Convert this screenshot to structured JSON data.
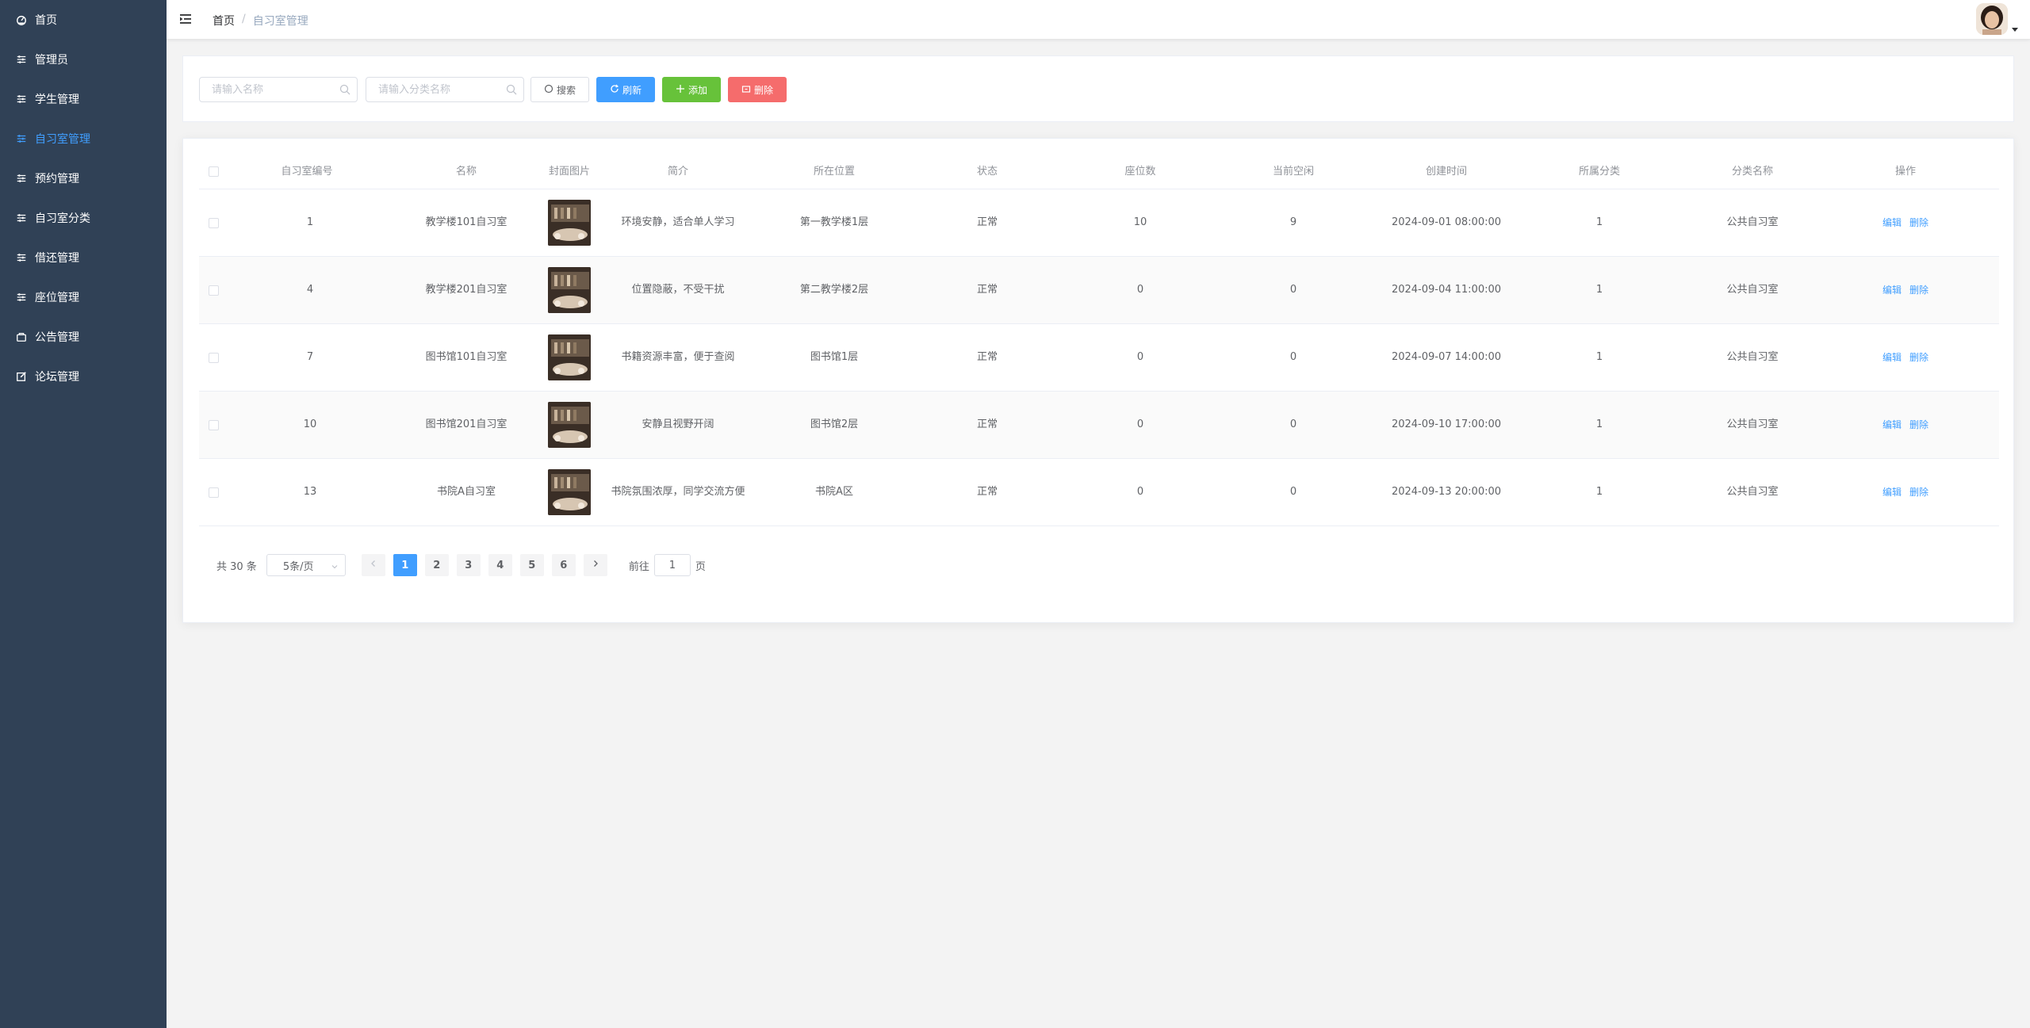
{
  "sidebar": {
    "items": [
      {
        "label": "首页",
        "icon": "dashboard-icon",
        "active": false
      },
      {
        "label": "管理员",
        "icon": "list-icon",
        "active": false
      },
      {
        "label": "学生管理",
        "icon": "list-icon",
        "active": false
      },
      {
        "label": "自习室管理",
        "icon": "list-icon",
        "active": true
      },
      {
        "label": "预约管理",
        "icon": "list-icon",
        "active": false
      },
      {
        "label": "自习室分类",
        "icon": "list-icon",
        "active": false
      },
      {
        "label": "借还管理",
        "icon": "list-icon",
        "active": false
      },
      {
        "label": "座位管理",
        "icon": "list-icon",
        "active": false
      },
      {
        "label": "公告管理",
        "icon": "bag-icon",
        "active": false
      },
      {
        "label": "论坛管理",
        "icon": "edit-icon",
        "active": false
      }
    ]
  },
  "header": {
    "breadcrumb": {
      "home": "首页",
      "separator": "/",
      "current": "自习室管理"
    }
  },
  "search": {
    "name_placeholder": "请输入名称",
    "category_placeholder": "请输入分类名称",
    "search_label": "搜索",
    "refresh_label": "刷新",
    "add_label": "添加",
    "delete_label": "删除"
  },
  "table": {
    "headers": {
      "no": "自习室编号",
      "name": "名称",
      "img": "封面图片",
      "intro": "简介",
      "loc": "所在位置",
      "status": "状态",
      "seats": "座位数",
      "free": "当前空闲",
      "time": "创建时间",
      "cat": "所属分类",
      "catname": "分类名称",
      "ops": "操作"
    },
    "rows": [
      {
        "no": "1",
        "name": "教学楼101自习室",
        "intro": "环境安静，适合单人学习",
        "loc": "第一教学楼1层",
        "status": "正常",
        "seats": "10",
        "free": "9",
        "time": "2024-09-01 08:00:00",
        "cat": "1",
        "catname": "公共自习室"
      },
      {
        "no": "4",
        "name": "教学楼201自习室",
        "intro": "位置隐蔽，不受干扰",
        "loc": "第二教学楼2层",
        "status": "正常",
        "seats": "0",
        "free": "0",
        "time": "2024-09-04 11:00:00",
        "cat": "1",
        "catname": "公共自习室"
      },
      {
        "no": "7",
        "name": "图书馆101自习室",
        "intro": "书籍资源丰富，便于查阅",
        "loc": "图书馆1层",
        "status": "正常",
        "seats": "0",
        "free": "0",
        "time": "2024-09-07 14:00:00",
        "cat": "1",
        "catname": "公共自习室"
      },
      {
        "no": "10",
        "name": "图书馆201自习室",
        "intro": "安静且视野开阔",
        "loc": "图书馆2层",
        "status": "正常",
        "seats": "0",
        "free": "0",
        "time": "2024-09-10 17:00:00",
        "cat": "1",
        "catname": "公共自习室"
      },
      {
        "no": "13",
        "name": "书院A自习室",
        "intro": "书院氛围浓厚，同学交流方便",
        "loc": "书院A区",
        "status": "正常",
        "seats": "0",
        "free": "0",
        "time": "2024-09-13 20:00:00",
        "cat": "1",
        "catname": "公共自习室"
      }
    ],
    "edit_label": "编辑",
    "delete_label": "删除"
  },
  "pagination": {
    "total": "共 30 条",
    "page_size": "5条/页",
    "pages": [
      "1",
      "2",
      "3",
      "4",
      "5",
      "6"
    ],
    "current": "1",
    "goto_prefix": "前往",
    "goto_value": "1",
    "goto_suffix": "页"
  },
  "colors": {
    "sidebar_bg": "#304156",
    "accent": "#409eff",
    "success": "#67c23a",
    "danger": "#f56c6c"
  }
}
